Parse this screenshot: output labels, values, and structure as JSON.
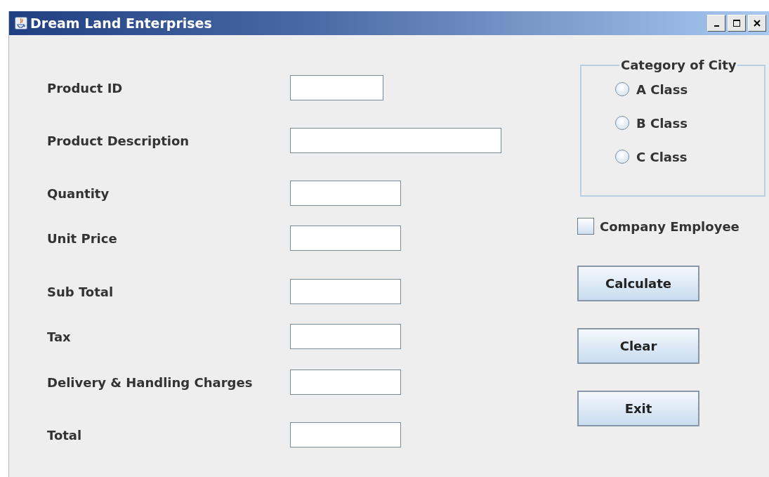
{
  "window": {
    "title": "Dream Land Enterprises"
  },
  "fields": [
    {
      "label": "Product ID"
    },
    {
      "label": "Product Description"
    },
    {
      "label": "Quantity"
    },
    {
      "label": "Unit Price"
    },
    {
      "label": "Sub Total"
    },
    {
      "label": "Tax"
    },
    {
      "label": "Delivery & Handling Charges"
    },
    {
      "label": "Total"
    }
  ],
  "city_group": {
    "title": "Category of City",
    "options": [
      {
        "label": "A Class",
        "selected": false
      },
      {
        "label": "B Class",
        "selected": false
      },
      {
        "label": "C Class",
        "selected": false
      }
    ]
  },
  "employee_checkbox": {
    "label": "Company Employee",
    "checked": false
  },
  "buttons": [
    "Calculate",
    "Clear",
    "Exit"
  ]
}
